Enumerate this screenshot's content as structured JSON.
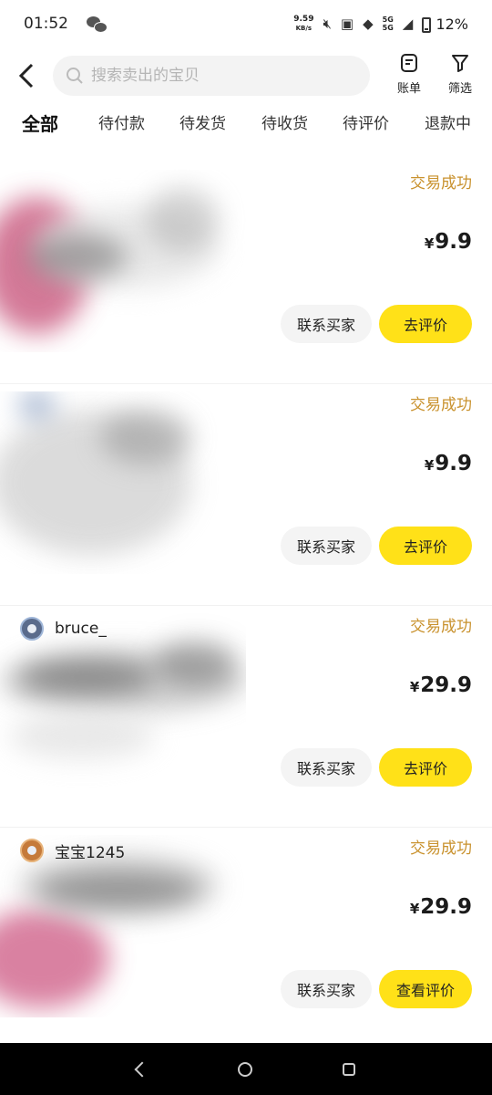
{
  "status_bar": {
    "time": "01:52",
    "net_speed_value": "9.59",
    "net_speed_unit": "KB/s",
    "signal_label_top": "5G",
    "signal_label_bottom": "5G",
    "battery": "12%"
  },
  "header": {
    "search_placeholder": "搜索卖出的宝贝",
    "bill_label": "账单",
    "filter_label": "筛选"
  },
  "tabs": [
    {
      "label": "全部",
      "active": true
    },
    {
      "label": "待付款"
    },
    {
      "label": "待发货"
    },
    {
      "label": "待收货"
    },
    {
      "label": "待评价"
    },
    {
      "label": "退款中"
    }
  ],
  "orders": [
    {
      "buyer": "",
      "status": "交易成功",
      "currency": "¥",
      "price": "9.9",
      "contact_label": "联系买家",
      "action_label": "去评价"
    },
    {
      "buyer": "",
      "status": "交易成功",
      "currency": "¥",
      "price": "9.9",
      "contact_label": "联系买家",
      "action_label": "去评价"
    },
    {
      "buyer": "bruce_",
      "status": "交易成功",
      "currency": "¥",
      "price": "29.9",
      "contact_label": "联系买家",
      "action_label": "去评价"
    },
    {
      "buyer": "宝宝1245",
      "status": "交易成功",
      "currency": "¥",
      "price": "29.9",
      "contact_label": "联系买家",
      "action_label": "查看评价"
    }
  ],
  "colors": {
    "accent_yellow": "#ffe118",
    "status_gold": "#c9922e"
  }
}
